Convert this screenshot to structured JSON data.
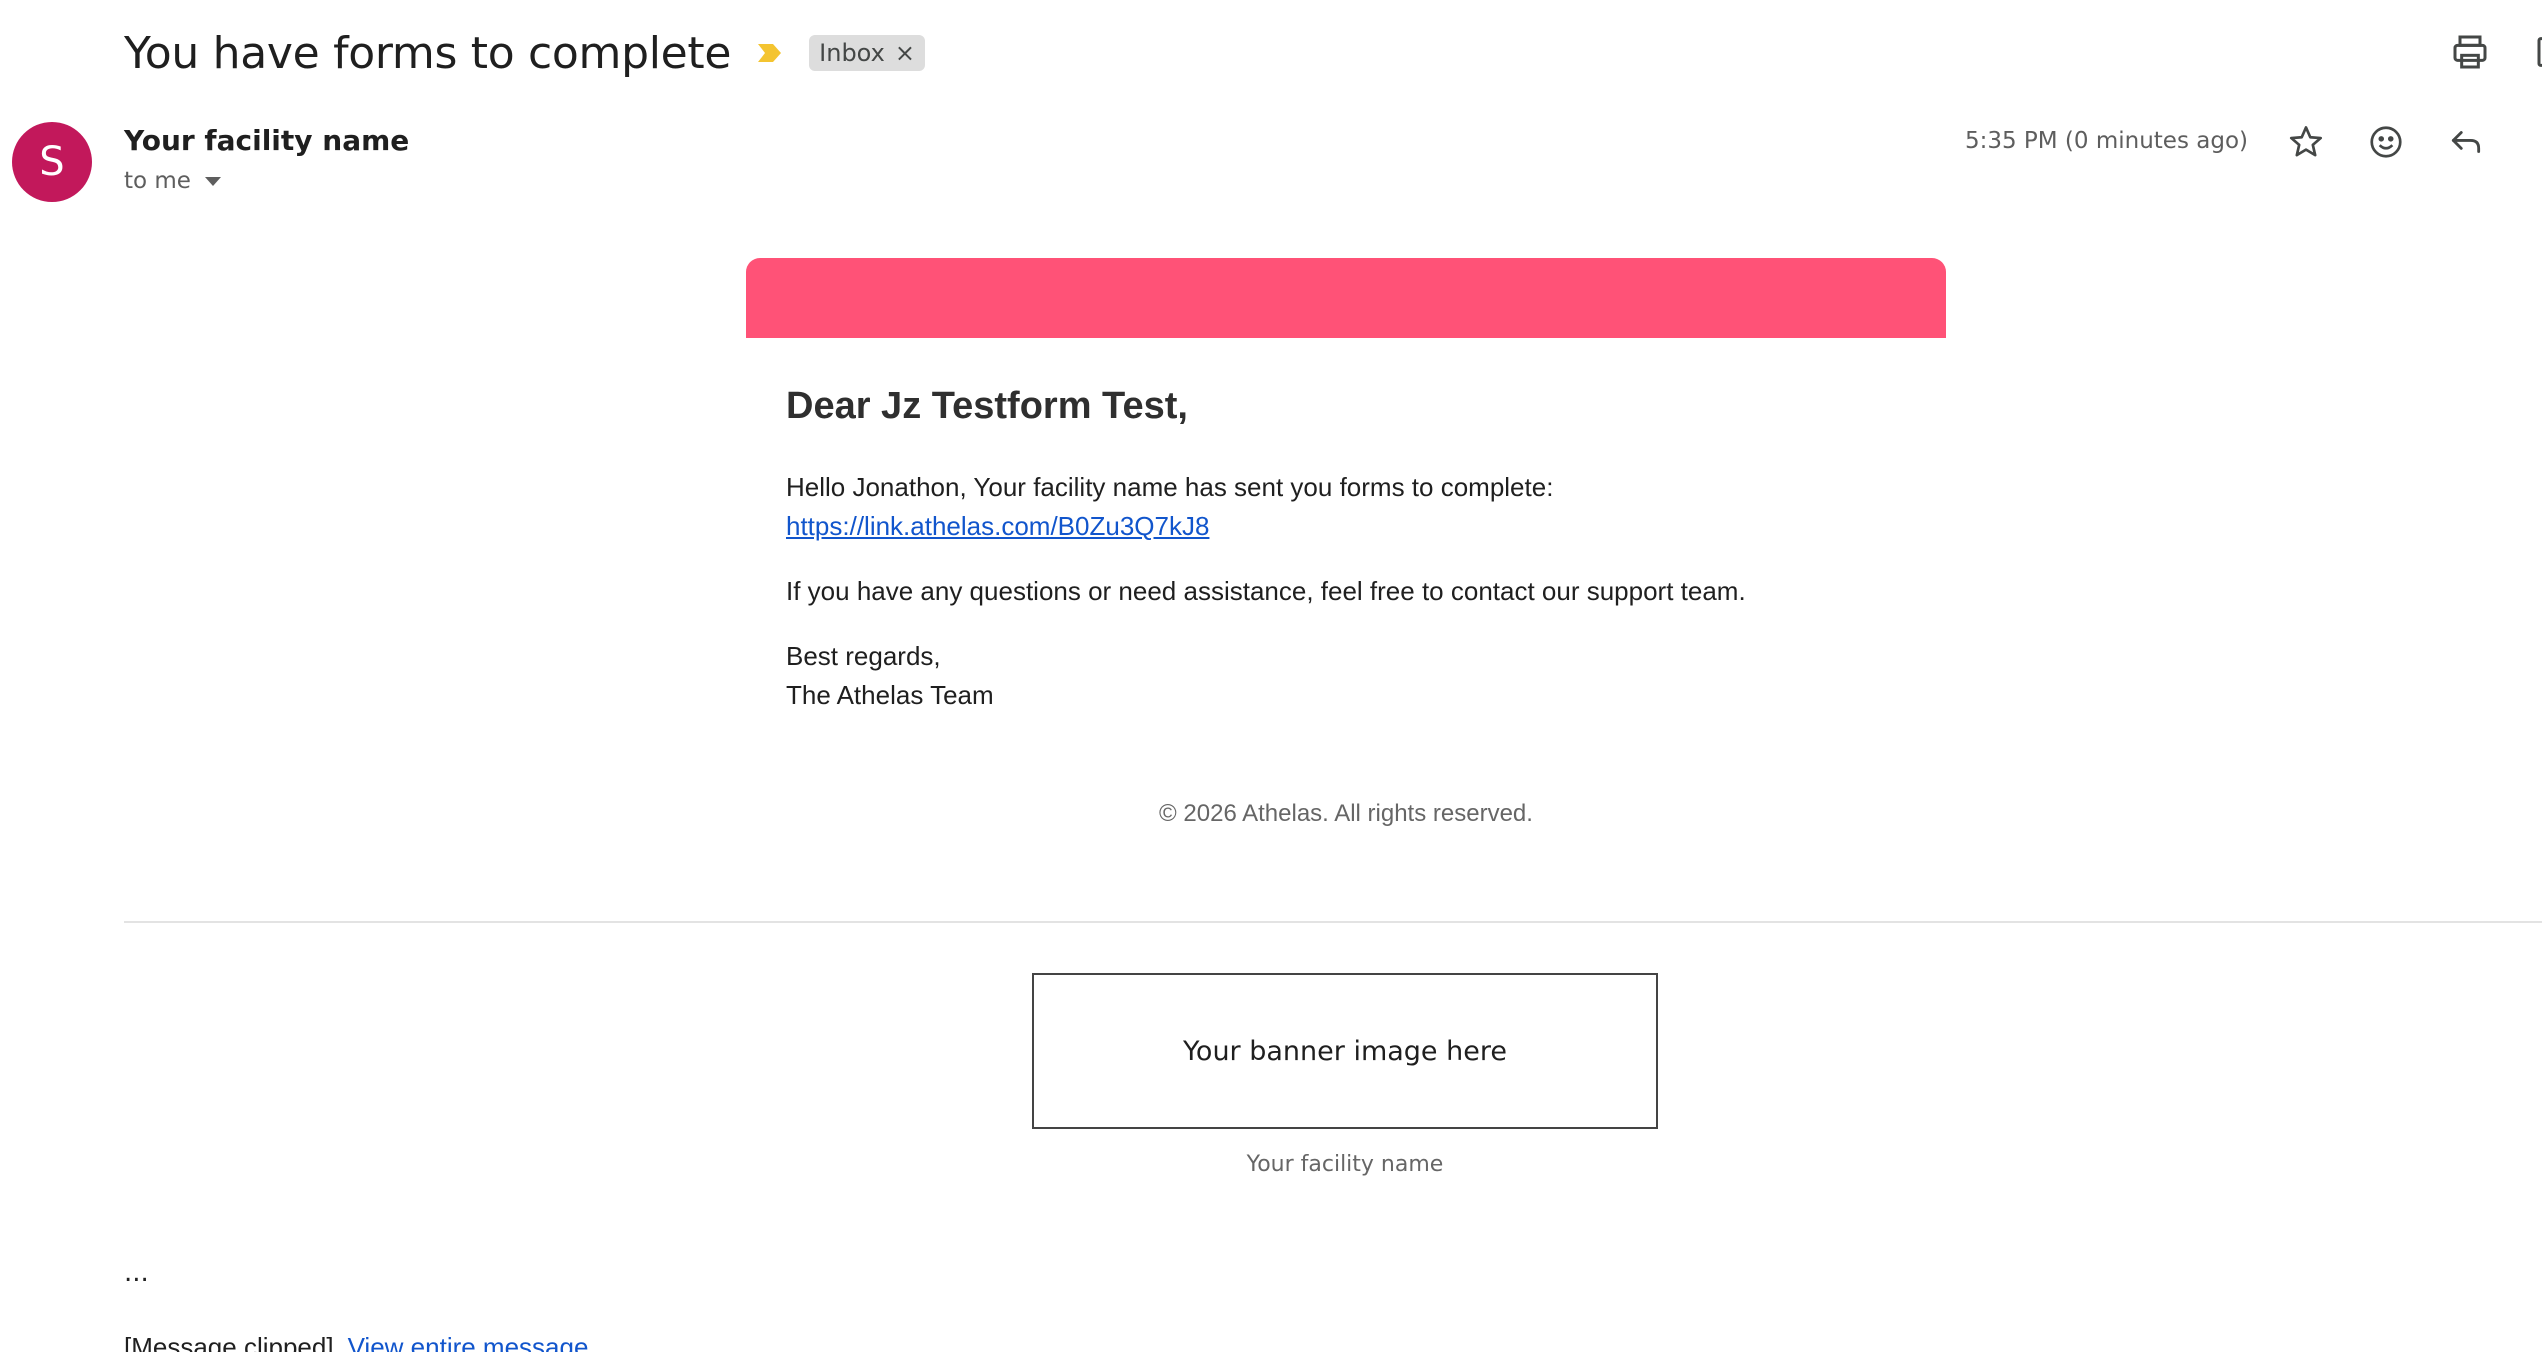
{
  "header": {
    "subject": "You have forms to complete",
    "label_chip": "Inbox",
    "chip_close": "×",
    "icons": [
      "print-icon",
      "open-in-new-window-icon"
    ]
  },
  "message": {
    "avatar_letter": "S",
    "sender_name": "Your facility name",
    "recipient": "to me",
    "timestamp": "5:35 PM (0 minutes ago)",
    "actions": [
      "star-icon",
      "emoji-reaction-icon",
      "reply-icon"
    ]
  },
  "email": {
    "greeting": "Dear Jz Testform Test,",
    "intro_text": "Hello Jonathon, Your facility name has sent you forms to complete: ",
    "link_text": "https://link.athelas.com/B0Zu3Q7kJ8",
    "support_text": "If you have any questions or need assistance, feel free to contact our support team.",
    "signoff": "Best regards,",
    "team": "The Athelas Team",
    "copyright": "© 2026 Athelas. All rights reserved.",
    "banner_placeholder": "Your banner image here",
    "footer_facility": "Your facility name"
  },
  "clipped": {
    "ellipsis": "...",
    "notice": "[Message clipped]",
    "view_link": "View entire message"
  },
  "colors": {
    "header_bar": "#ff5277",
    "avatar": "#c2185b",
    "link": "#1155cc",
    "importance_marker": "#f4c430"
  }
}
